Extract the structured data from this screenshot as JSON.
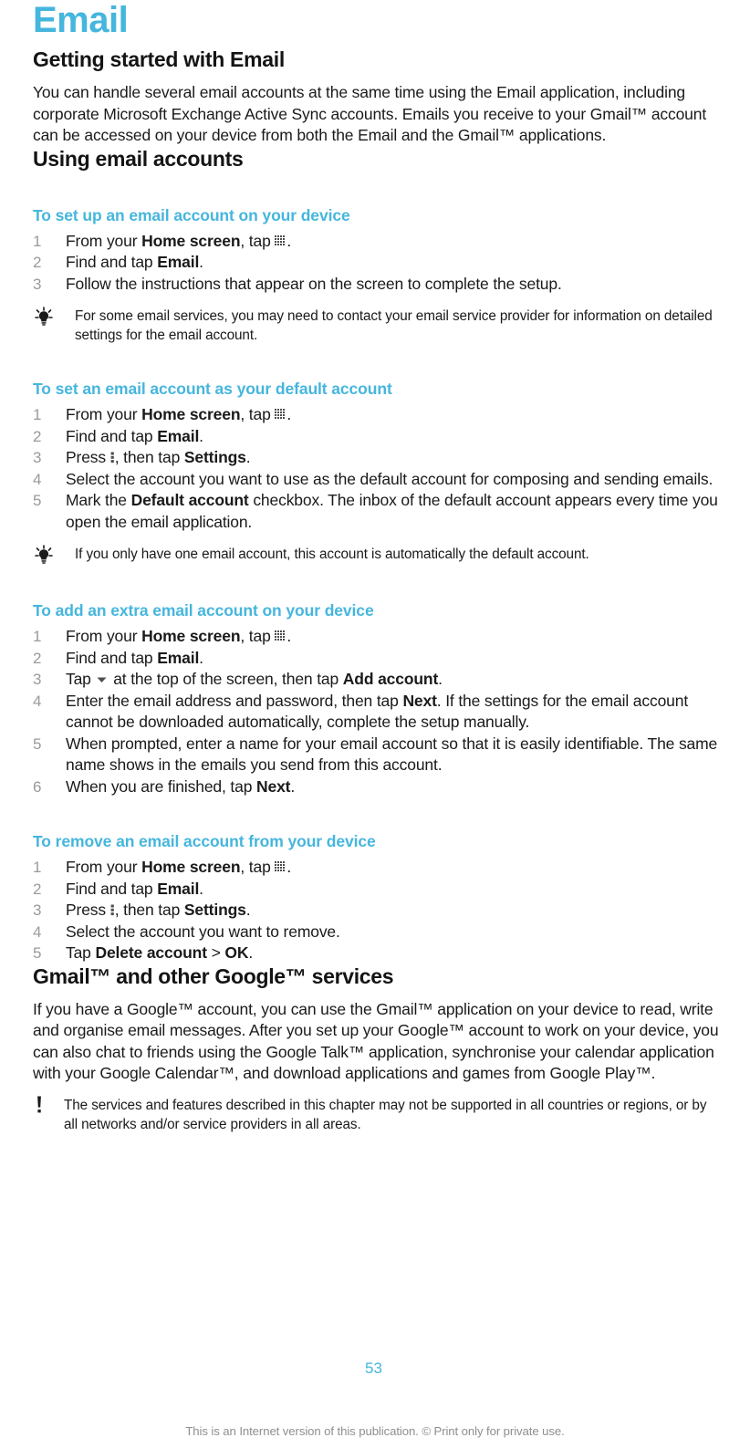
{
  "document": {
    "chapter_title": "Email",
    "page_number": "53",
    "footer": "This is an Internet version of this publication. © Print only for private use.",
    "accent_color": "#45b6dd",
    "text_color": "#1a1a1a",
    "number_color": "#9a9a9a",
    "footer_color": "#8f8f8f"
  },
  "sections": {
    "getting_started": {
      "heading": "Getting started with Email",
      "paragraph": "You can handle several email accounts at the same time using the Email application, including corporate Microsoft Exchange Active Sync accounts. Emails you receive to your Gmail™ account can be accessed on your device from both the Email and the Gmail™ applications."
    },
    "using_email_accounts": {
      "heading": "Using email accounts"
    },
    "gmail_services": {
      "heading": "Gmail™ and other Google™ services",
      "paragraph": "If you have a Google™ account, you can use the Gmail™ application on your device to read, write and organise email messages. After you set up your Google™ account to work on your device, you can also chat to friends using the Google Talk™ application, synchronise your calendar application with your Google Calendar™, and download applications and games from Google Play™.",
      "warning": "The services and features described in this chapter may not be supported in all countries or regions, or by all networks and/or service providers in all areas."
    }
  },
  "procedures": [
    {
      "title": "To set up an email account on your device",
      "steps": [
        {
          "prefix": "From your ",
          "bold1": "Home screen",
          "mid": ", tap ",
          "icon": "app-grid-icon",
          "suffix": "."
        },
        {
          "prefix": "Find and tap ",
          "bold1": "Email",
          "suffix": "."
        },
        {
          "prefix": "Follow the instructions that appear on the screen to complete the setup."
        }
      ],
      "tip": "For some email services, you may need to contact your email service provider for information on detailed settings for the email account."
    },
    {
      "title": "To set an email account as your default account",
      "steps": [
        {
          "prefix": "From your ",
          "bold1": "Home screen",
          "mid": ", tap ",
          "icon": "app-grid-icon",
          "suffix": "."
        },
        {
          "prefix": "Find and tap ",
          "bold1": "Email",
          "suffix": "."
        },
        {
          "prefix": "Press ",
          "icon": "menu-dots-icon",
          "mid": ", then tap ",
          "bold1": "Settings",
          "suffix": "."
        },
        {
          "prefix": "Select the account you want to use as the default account for composing and sending emails."
        },
        {
          "prefix": "Mark the ",
          "bold1": "Default account",
          "suffix": " checkbox. The inbox of the default account appears every time you open the email application."
        }
      ],
      "tip": "If you only have one email account, this account is automatically the default account."
    },
    {
      "title": "To add an extra email account on your device",
      "steps": [
        {
          "prefix": "From your ",
          "bold1": "Home screen",
          "mid": ", tap ",
          "icon": "app-grid-icon",
          "suffix": "."
        },
        {
          "prefix": "Find and tap ",
          "bold1": "Email",
          "suffix": "."
        },
        {
          "prefix": "Tap ",
          "icon": "caret-down-icon",
          "mid": " at the top of the screen, then tap ",
          "bold1": "Add account",
          "suffix": "."
        },
        {
          "prefix": "Enter the email address and password, then tap ",
          "bold1": "Next",
          "suffix": ". If the settings for the email account cannot be downloaded automatically, complete the setup manually."
        },
        {
          "prefix": "When prompted, enter a name for your email account so that it is easily identifiable. The same name shows in the emails you send from this account."
        },
        {
          "prefix": "When you are finished, tap ",
          "bold1": "Next",
          "suffix": "."
        }
      ]
    },
    {
      "title": "To remove an email account from your device",
      "steps": [
        {
          "prefix": "From your ",
          "bold1": "Home screen",
          "mid": ", tap ",
          "icon": "app-grid-icon",
          "suffix": "."
        },
        {
          "prefix": "Find and tap ",
          "bold1": "Email",
          "suffix": "."
        },
        {
          "prefix": "Press ",
          "icon": "menu-dots-icon",
          "mid": ", then tap ",
          "bold1": "Settings",
          "suffix": "."
        },
        {
          "prefix": "Select the account you want to remove."
        },
        {
          "prefix": "Tap ",
          "bold1": "Delete account",
          "mid": " > ",
          "bold2": "OK",
          "suffix": "."
        }
      ]
    }
  ]
}
